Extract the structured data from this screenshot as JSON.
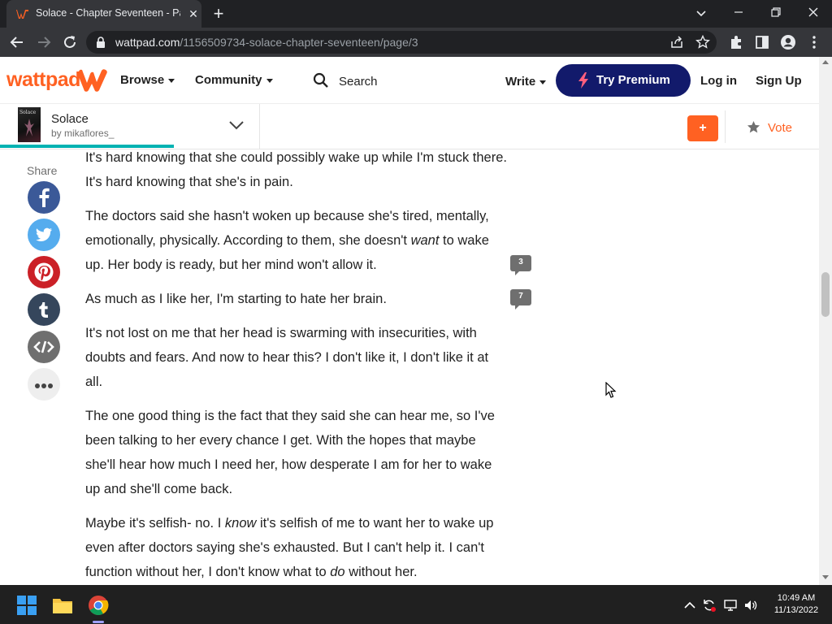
{
  "browser": {
    "tab_title": "Solace - Chapter Seventeen - Pag",
    "url_host": "wattpad.com",
    "url_path": "/1156509734-solace-chapter-seventeen/page/3"
  },
  "header": {
    "logo_text": "wattpad",
    "browse_label": "Browse",
    "community_label": "Community",
    "search_label": "Search",
    "write_label": "Write",
    "premium_label": "Try Premium",
    "login_label": "Log in",
    "signup_label": "Sign Up"
  },
  "story": {
    "cover_text": "Solace",
    "title": "Solace",
    "author": "by mikaflores_",
    "reading_progress": 0.67,
    "add_label": "+",
    "vote_label": "Vote"
  },
  "share": {
    "label": "Share",
    "buttons": [
      {
        "name": "facebook",
        "color": "#3b5998"
      },
      {
        "name": "twitter",
        "color": "#55acee"
      },
      {
        "name": "pinterest",
        "color": "#cb2027"
      },
      {
        "name": "tumblr",
        "color": "#35465c"
      },
      {
        "name": "embed",
        "color": "#6f6f6f"
      },
      {
        "name": "more",
        "color": "#eeeeee"
      }
    ]
  },
  "content": {
    "paragraphs": [
      {
        "parts": [
          {
            "text": "  It's hard knowing that she could possibly wake up while I'm stuck there. It's hard knowing that she's in pain."
          }
        ]
      },
      {
        "parts": [
          {
            "text": "The doctors said she hasn't woken up because she's tired, mentally, emotionally, physically. According to them, she doesn't "
          },
          {
            "text": "want",
            "italic": true
          },
          {
            "text": " to wake up. Her body is ready, but her mind won't allow it."
          }
        ]
      },
      {
        "parts": [
          {
            "text": "As much as I like her, I'm starting to hate her brain."
          }
        ]
      },
      {
        "parts": [
          {
            "text": "It's not lost on me that her head is swarming with insecurities, with doubts and fears. And now to hear this? I don't like it, I don't like it at all."
          }
        ]
      },
      {
        "parts": [
          {
            "text": "The one good thing is the fact that they said she can hear me, so I've been talking to her every chance I get. With the hopes that maybe she'll hear how much I need her, how desperate I am for her to wake up and she'll come back."
          }
        ]
      },
      {
        "parts": [
          {
            "text": "Maybe it's selfish- no. I "
          },
          {
            "text": "know",
            "italic": true
          },
          {
            "text": " it's selfish of me to want her to wake up even after doctors saying she's exhausted. But I can't help it. I can't function without her, I don't know what to "
          },
          {
            "text": "do",
            "italic": true
          },
          {
            "text": " without her."
          }
        ]
      }
    ],
    "comment_counts": [
      "3",
      "7"
    ]
  },
  "taskbar": {
    "time": "10:49 AM",
    "date": "11/13/2022"
  },
  "colors": {
    "brand_orange": "#ff6122",
    "premium_navy": "#121a6b",
    "progress_teal": "#00b2b2"
  }
}
